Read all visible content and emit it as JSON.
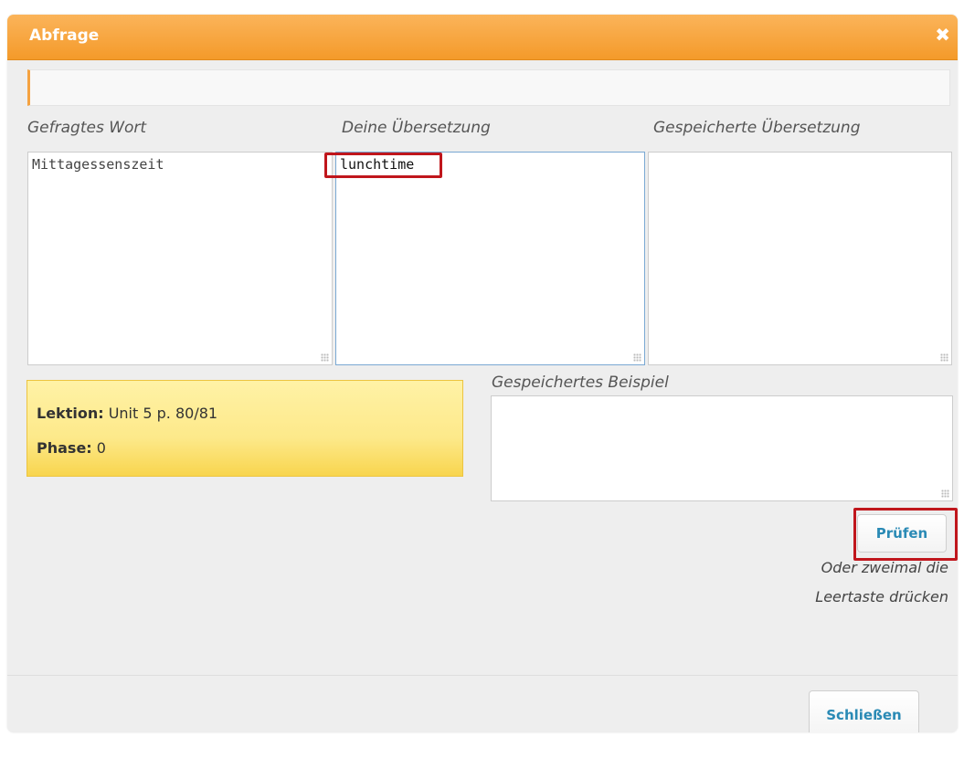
{
  "dialog": {
    "title": "Abfrage",
    "close_icon": "close-icon"
  },
  "columns": {
    "asked_label": "Gefragtes Wort",
    "yours_label": "Deine Übersetzung",
    "saved_label": "Gespeicherte Übersetzung"
  },
  "fields": {
    "asked_word": "Mittagessenszeit",
    "your_translation": "lunchtime",
    "saved_translation": "",
    "saved_example": ""
  },
  "example_label": "Gespeichertes Beispiel",
  "info": {
    "lesson_label": "Lektion:",
    "lesson_value": "Unit 5 p. 80/81",
    "phase_label": "Phase:",
    "phase_value": "0"
  },
  "check_button": "Prüfen",
  "hint_line1": "Oder zweimal die",
  "hint_line2": "Leertaste drücken",
  "close_button": "Schließen",
  "colors": {
    "titlebar": "#f49a2a",
    "highlight": "#c0161c",
    "button_text": "#2a8ab5",
    "info_box": "#fde98a"
  }
}
